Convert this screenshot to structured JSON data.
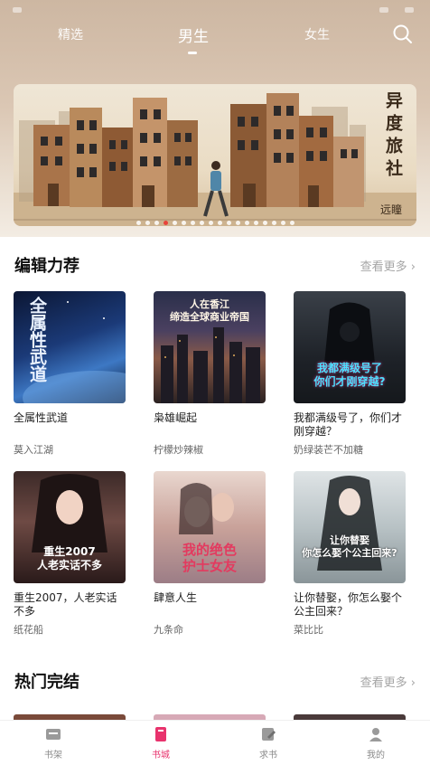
{
  "top_tabs": {
    "featured": "精选",
    "male": "男生",
    "female": "女生"
  },
  "banner": {
    "title": "异度旅社",
    "author": "远瞳",
    "slide_count": 18,
    "active_slide": 3
  },
  "sections": {
    "editor_picks": {
      "title": "编辑力荐",
      "more": "查看更多 ›"
    },
    "completed": {
      "title": "热门完结",
      "more": "查看更多 ›"
    }
  },
  "books": [
    {
      "name": "全属性武道",
      "author": "莫入江湖",
      "cover_text": "全属性武道"
    },
    {
      "name": "枭雄崛起",
      "author": "柠檬炒辣椒",
      "cover_text": "人在香江\n缔造全球商业帝国"
    },
    {
      "name": "我都满级号了，你们才刚穿越？",
      "author": "奶绿装芒不加糖",
      "cover_text": "我都满级号了\n你们才刚穿越?"
    },
    {
      "name": "重生2007，人老实话不多",
      "author": "纸花船",
      "cover_text": "重生2007\n人老实话不多"
    },
    {
      "name": "肆意人生",
      "author": "九条命",
      "cover_text": "我的绝色\n护士女友"
    },
    {
      "name": "让你替娶，你怎么娶个公主回来？",
      "author": "菜比比",
      "cover_text": "让你替娶\n你怎么娶个公主回来?"
    }
  ],
  "bottom_nav": [
    {
      "label": "书架",
      "icon": "bookshelf-icon"
    },
    {
      "label": "书城",
      "icon": "bookstore-icon"
    },
    {
      "label": "求书",
      "icon": "request-book-icon"
    },
    {
      "label": "我的",
      "icon": "profile-icon"
    }
  ],
  "colors": {
    "accent": "#e8336d",
    "banner_dot_active": "#e8433a"
  }
}
